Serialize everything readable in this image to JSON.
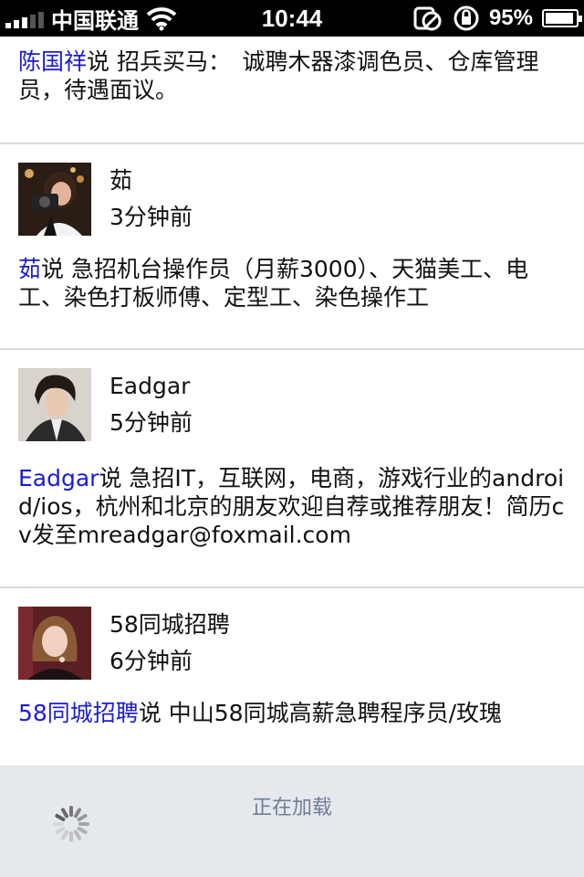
{
  "status_bar": {
    "carrier": "中国联通",
    "time": "10:44",
    "battery_percent": "95%",
    "battery_level": 0.95,
    "signal_bars": 3,
    "icons": [
      "signal-icon",
      "wifi-icon",
      "orientation-lock-icon",
      "alarm-icon",
      "battery-charging-icon"
    ]
  },
  "feed": {
    "top_partial_post": {
      "author": "陈国祥",
      "says": "说",
      "content": " 招兵买马：　诚聘木器漆调色员、仓库管理员，待遇面议。"
    },
    "posts": [
      {
        "author": "茹",
        "time": "3分钟前",
        "says": "说",
        "content": " 急招机台操作员（月薪3000）、天猫美工、电工、染色打板师傅、定型工、染色操作工"
      },
      {
        "author": "Eadgar",
        "time": "5分钟前",
        "says": "说",
        "content": " 急招IT，互联网，电商，游戏行业的android/ios，杭州和北京的朋友欢迎自荐或推荐朋友！简历cv发至mreadgar@foxmail.com"
      },
      {
        "author": "58同城招聘",
        "time": "6分钟前",
        "says": "说",
        "content": " 中山58同城高薪急聘程序员/玫瑰"
      }
    ]
  },
  "loading": {
    "text": "正在加载",
    "icon": "spinner-icon"
  },
  "colors": {
    "author_link": "#1b1bd6",
    "loading_bg": "#e5e8ed",
    "loading_text": "#6f7f93",
    "divider": "#d9d9d9"
  }
}
